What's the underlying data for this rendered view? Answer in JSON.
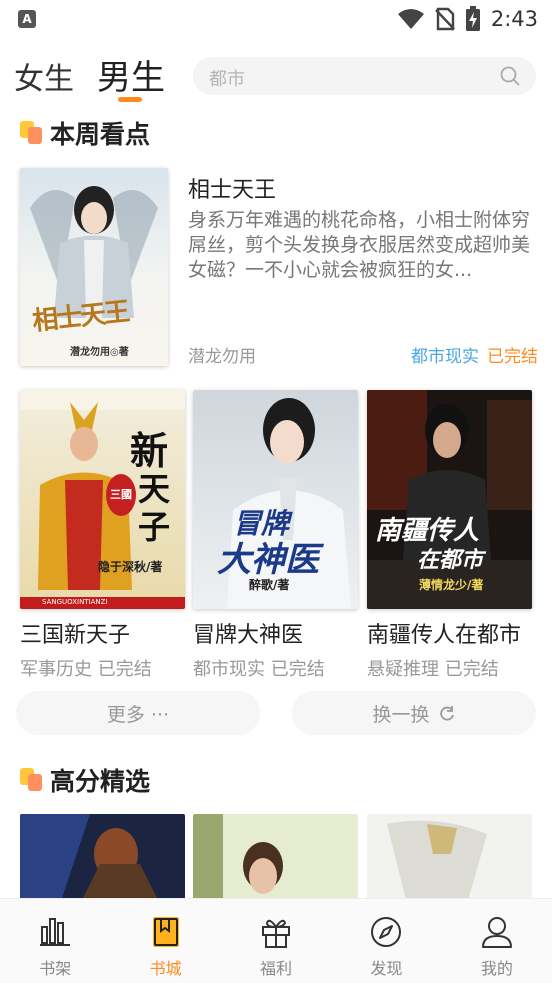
{
  "status_bar": {
    "time": "2:43",
    "app_badge": "A"
  },
  "header": {
    "tabs": [
      {
        "label": "女生",
        "active": false
      },
      {
        "label": "男生",
        "active": true
      }
    ],
    "search": {
      "placeholder": "都市"
    }
  },
  "colors": {
    "accent": "#ff8a1f",
    "category_blue": "#4ba8e0",
    "muted": "#999999"
  },
  "weekly": {
    "title": "本周看点",
    "featured": {
      "title": "相士天王",
      "description": "身系万年难遇的桃花命格，小相士附体穷屌丝，剪个头发换身衣服居然变成超帅美女磁？一不小心就会被疯狂的女...",
      "author": "潜龙勿用",
      "category": "都市现实",
      "status": "已完结",
      "cover": {
        "title_art": "相士天王",
        "author_art": "潜龙勿用",
        "suffix": "著"
      }
    },
    "books": [
      {
        "title": "三国新天子",
        "category": "军事历史",
        "status": "已完结",
        "cover": {
          "art1": "新",
          "art2": "天",
          "art3": "子",
          "seal": "三國",
          "author_art": "隐于深秋",
          "suffix": "著",
          "footer": "SANGUOXINTIANZI"
        }
      },
      {
        "title": "冒牌大神医",
        "category": "都市现实",
        "status": "已完结",
        "cover": {
          "art1": "冒牌",
          "art2": "大神医",
          "author_art": "醉歌",
          "suffix": "著"
        }
      },
      {
        "title": "南疆传人在都市",
        "category": "悬疑推理",
        "status": "已完结",
        "cover": {
          "art1": "南疆传人",
          "art2": "在都市",
          "author_art": "薄情龙少",
          "suffix": "著"
        }
      }
    ],
    "more_label": "更多 ···",
    "refresh_label": "换一换"
  },
  "high_score": {
    "title": "高分精选"
  },
  "bottom_nav": [
    {
      "label": "书架",
      "icon": "bar-chart-icon",
      "active": false
    },
    {
      "label": "书城",
      "icon": "bookmark-book-icon",
      "active": true
    },
    {
      "label": "福利",
      "icon": "gift-icon",
      "active": false
    },
    {
      "label": "发现",
      "icon": "compass-icon",
      "active": false
    },
    {
      "label": "我的",
      "icon": "person-icon",
      "active": false
    }
  ]
}
